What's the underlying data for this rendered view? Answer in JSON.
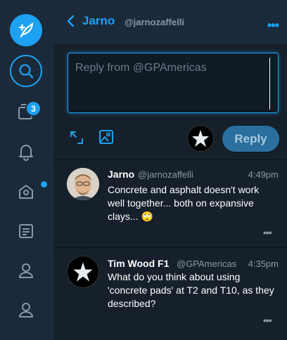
{
  "sidebar": {
    "compose_icon": "compose-feather-icon",
    "search_icon": "search-icon",
    "messages_badge": "3",
    "items": [
      "home-icon",
      "bell-icon",
      "notifications-home-icon",
      "list-icon",
      "user-icon",
      "user-icon"
    ]
  },
  "header": {
    "name": "Jarno",
    "handle": "@jarnozaffelli",
    "more": "•••"
  },
  "reply": {
    "placeholder": "Reply from @GPAmericas",
    "button": "Reply"
  },
  "tweets": [
    {
      "name": "Jarno",
      "handle": "@jarnozaffelli",
      "time": "4:49pm",
      "text": "Concrete and asphalt doesn't work well together... both on expansive clays... 🙄",
      "more": "•••"
    },
    {
      "name": "Tim Wood F1",
      "handle": "@GPAmericas",
      "time": "4:35pm",
      "text": "What do you think about using 'concrete pads' at T2 and T10, as they described?",
      "more": "•••"
    }
  ],
  "colors": {
    "accent": "#1da1f2",
    "background": "#15202b",
    "sidebar": "#1b2a3a"
  }
}
